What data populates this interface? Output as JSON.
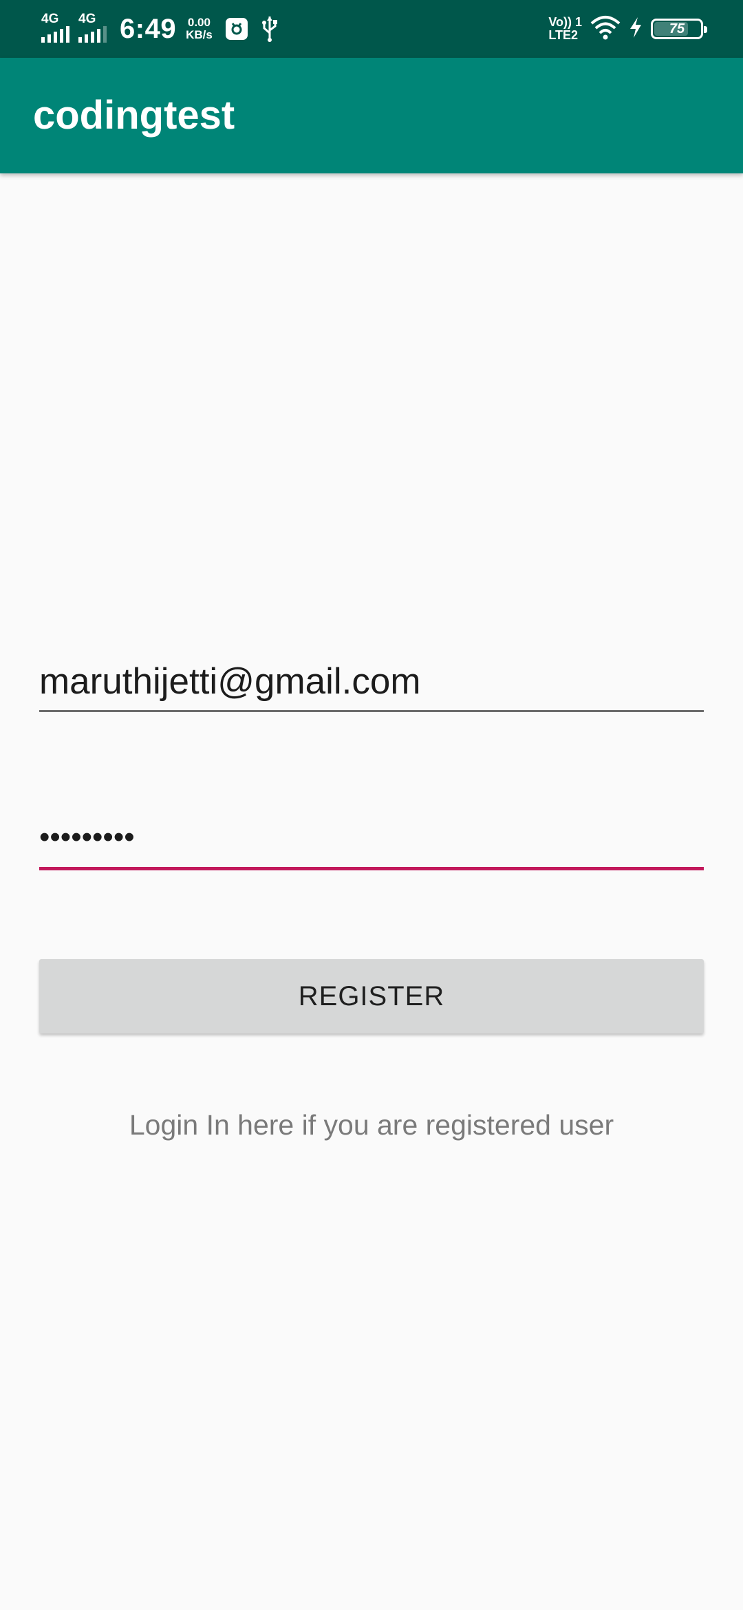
{
  "status_bar": {
    "sim1_network": "4G",
    "sim2_network": "4G",
    "time": "6:49",
    "data_speed_value": "0.00",
    "data_speed_unit": "KB/s",
    "volte_line1": "Vo)) 1",
    "volte_line2": "LTE2",
    "battery_level": "75",
    "battery_fraction": 0.75,
    "icons": [
      "usb-debug-icon",
      "usb-icon",
      "wifi-icon",
      "charging-bolt-icon",
      "battery-icon"
    ]
  },
  "app_bar": {
    "title": "codingtest"
  },
  "form": {
    "email_value": "maruthijetti@gmail.com",
    "password_mask": "•••••••••",
    "register_label": "REGISTER",
    "login_link": "Login In here if you are registered user"
  },
  "colors": {
    "status_bar": "#00574b",
    "app_bar": "#008577",
    "accent": "#c2185b",
    "button": "#d6d7d7",
    "background": "#fafafa"
  }
}
